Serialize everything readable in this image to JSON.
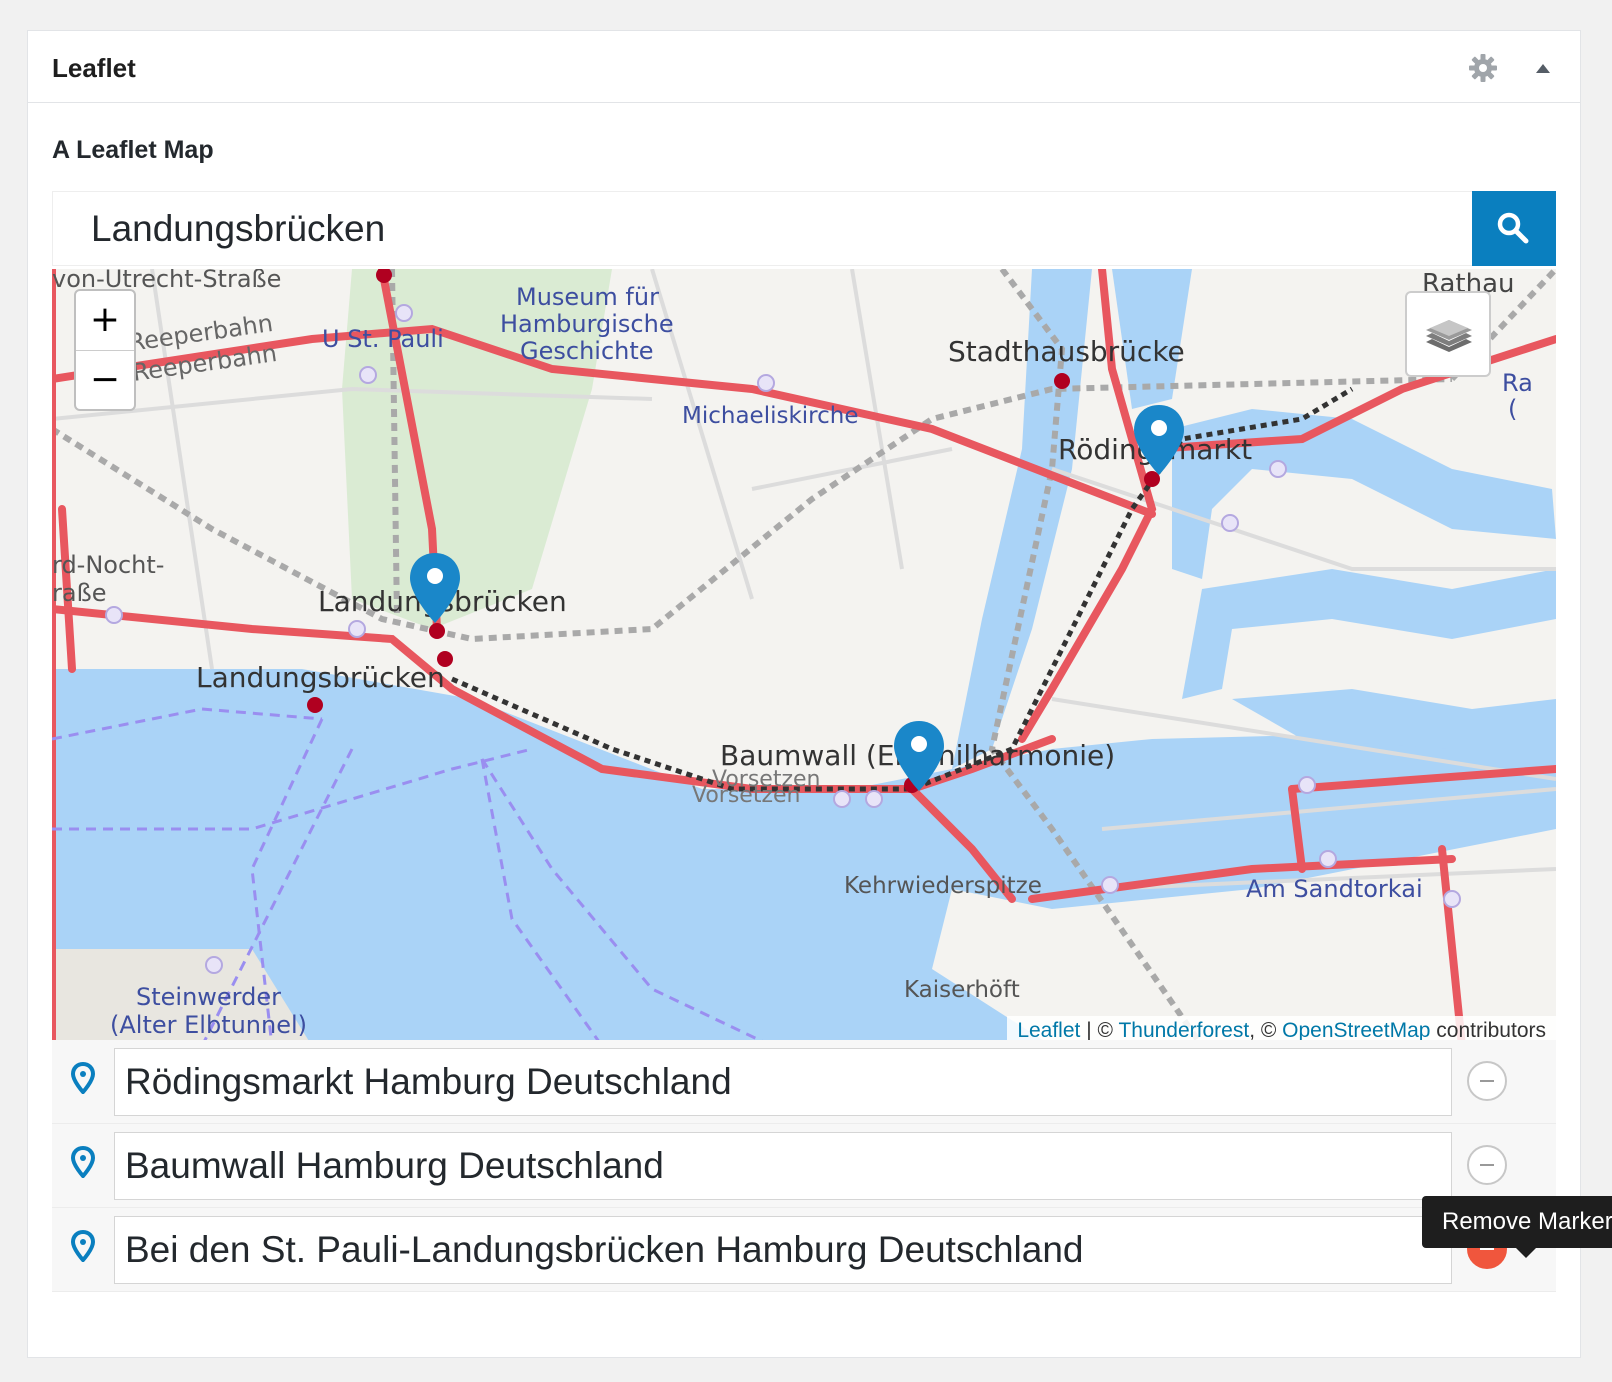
{
  "panel": {
    "title": "Leaflet",
    "settings_icon": "gear-icon",
    "collapse_icon": "triangle-up-icon"
  },
  "block": {
    "label": "A Leaflet Map"
  },
  "search": {
    "value": "Landungsbrücken",
    "button_icon": "search-icon",
    "button_color": "#0a7fbf"
  },
  "map": {
    "zoom_in_label": "+",
    "zoom_out_label": "−",
    "layers_icon": "layers-icon",
    "labels": {
      "utrecht": "von-Utrecht-Straße",
      "reeperbahn1": "Reeperbahn",
      "reeperbahn2": "Reeperbahn",
      "stpauli": "U St. Pauli",
      "museum1": "Museum für",
      "museum2": "Hamburgische",
      "museum3": "Geschichte",
      "rathaus": "Rathau",
      "stadthaus": "Stadthausbrücke",
      "michaelis": "Michaeliskirche",
      "roedingsmarkt": "Rödingsmarkt",
      "nocht1": "rd-Nocht-",
      "nocht2": "raße",
      "landungs1": "Landungsbrücken",
      "landungs2": "Landungsbrücken",
      "baumwall": "Baumwall (Elbphilharmonie)",
      "vorsetzen1": "Vorsetzen",
      "vorsetzen2": "Vorsetzen",
      "kehrwieder": "Kehrwiederspitze",
      "sandtorkai": "Am Sandtorkai",
      "steinwerder1": "Steinwerder",
      "steinwerder2": "(Alter Elbtunnel)",
      "kaiserhoeft": "Kaiserhöft",
      "edge_ra": "Ra",
      "edge_paren": "("
    },
    "attribution": {
      "leaflet": "Leaflet",
      "sep1": " | © ",
      "thunderforest": "Thunderforest",
      "sep2": ", © ",
      "osm": "OpenStreetMap",
      "suffix": " contributors"
    },
    "pin_color": "#1a87c9",
    "route_color": "#e8575f",
    "water_color": "#aad3f7"
  },
  "markers": [
    {
      "value": "Rödingsmarkt Hamburg Deutschland",
      "icon": "map-pin-icon",
      "remove_icon": "minus-circle-icon"
    },
    {
      "value": "Baumwall Hamburg Deutschland",
      "icon": "map-pin-icon",
      "remove_icon": "minus-circle-icon"
    },
    {
      "value": "Bei den St. Pauli-Landungsbrücken Hamburg Deutschland",
      "icon": "map-pin-icon",
      "remove_icon": "minus-circle-icon"
    }
  ],
  "tooltip": {
    "text": "Remove Marker"
  },
  "colors": {
    "accent": "#0a7fbf",
    "danger": "#f0563d"
  }
}
